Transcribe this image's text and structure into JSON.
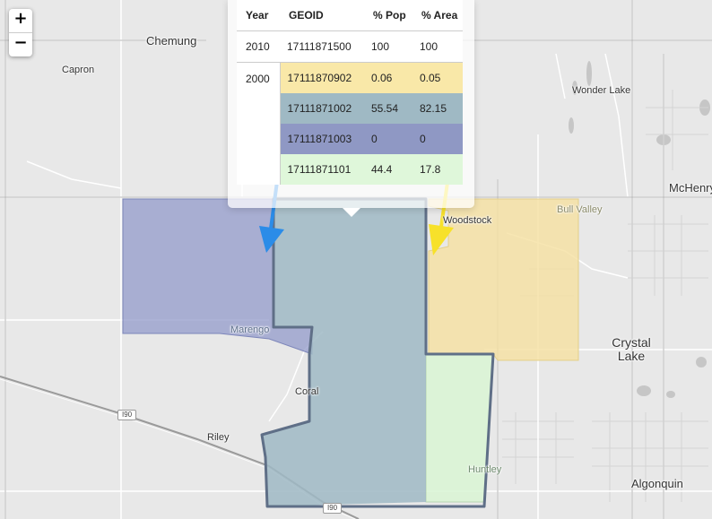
{
  "map": {
    "places": [
      "Chemung",
      "Capron",
      "Wonder Lake",
      "McHenry",
      "Bull Valley",
      "Woodstock",
      "Marengo",
      "Crystal Lake",
      "Coral",
      "Riley",
      "Huntley",
      "Algonquin"
    ],
    "highway_label": "I90",
    "colors": {
      "tract_yellow": "#f5e0a0",
      "tract_teal": "#9fb9c4",
      "tract_purple": "#8f97c9",
      "tract_green": "#d9f5d3",
      "outline": "#5f6f87",
      "arrow_blue": "#2b8ce8",
      "arrow_yellow": "#f7e12a"
    }
  },
  "zoom": {
    "in_label": "+",
    "out_label": "−"
  },
  "popup": {
    "headers": [
      "Year",
      "GEOID",
      "% Pop",
      "% Area"
    ],
    "rows": [
      {
        "year": "2010",
        "geoid": "17111871500",
        "pop": "100",
        "area": "100",
        "color": "#ffffff"
      },
      {
        "year": "2000",
        "geoid": "17111870902",
        "pop": "0.06",
        "area": "0.05",
        "color": "#f9e8a8"
      },
      {
        "year": "",
        "geoid": "17111871002",
        "pop": "55.54",
        "area": "82.15",
        "color": "#9fb9c4"
      },
      {
        "year": "",
        "geoid": "17111871003",
        "pop": "0",
        "area": "0",
        "color": "#8f98c4"
      },
      {
        "year": "",
        "geoid": "17111871101",
        "pop": "44.4",
        "area": "17.8",
        "color": "#dff7da"
      }
    ]
  }
}
